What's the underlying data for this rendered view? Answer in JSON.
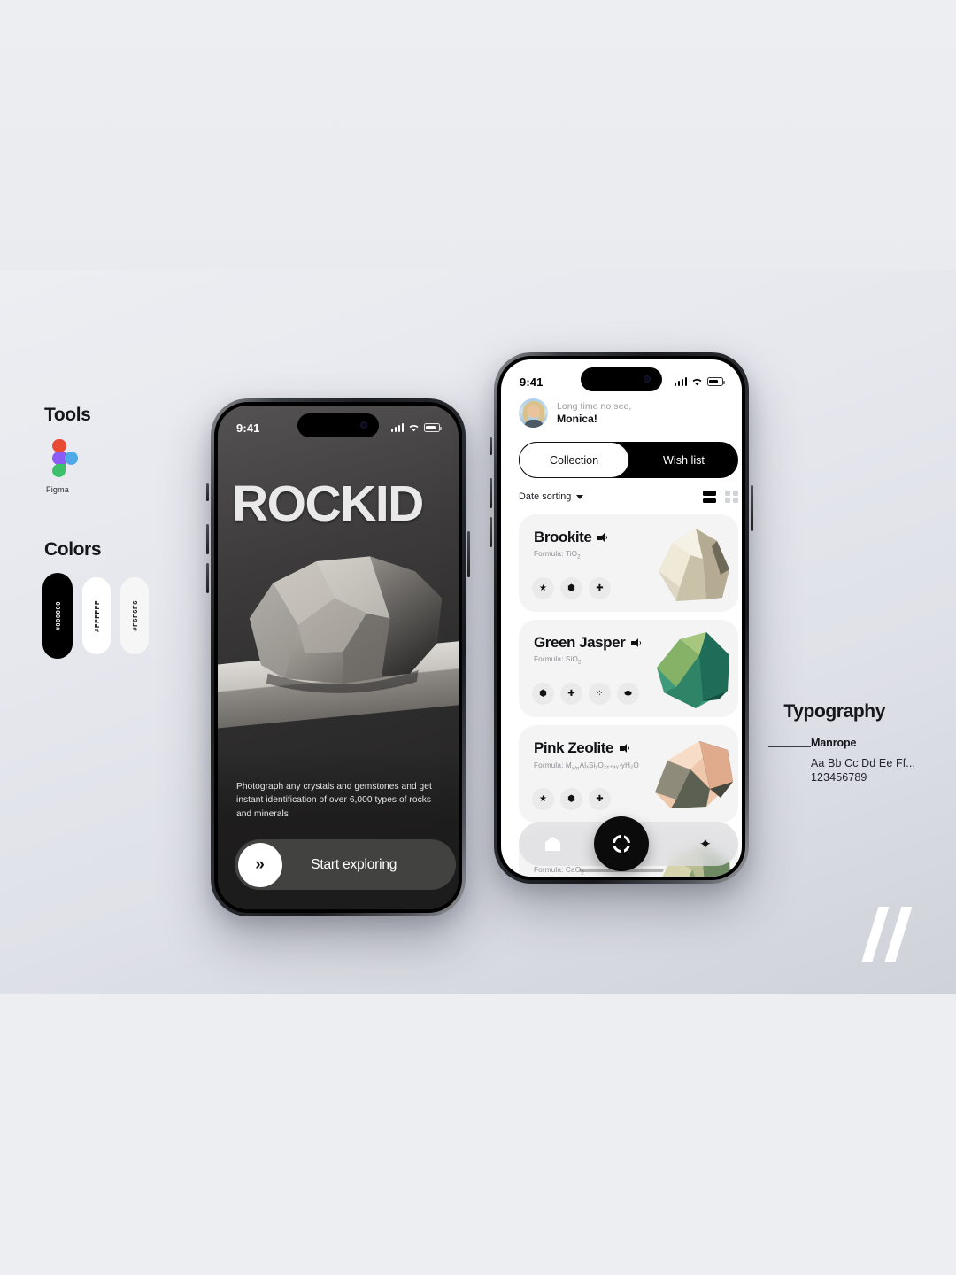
{
  "sidebar": {
    "tools": {
      "label": "Tools",
      "items": [
        {
          "name": "Figma",
          "icon": "figma-logo"
        }
      ]
    },
    "colors": {
      "label": "Colors",
      "swatches": [
        {
          "hex": "#000000",
          "label": "#000000"
        },
        {
          "hex": "#FFFFFF",
          "label": "#FFFFFF"
        },
        {
          "hex": "#F6F6F6",
          "label": "#F6F6F6"
        }
      ]
    }
  },
  "typography": {
    "label": "Typography",
    "font_name": "Manrope",
    "sample_letters": "Aa Bb Cc Dd Ee Ff...",
    "sample_numbers": "123456789"
  },
  "brand_mark": "double-slash",
  "phone_hero": {
    "status": {
      "time": "9:41",
      "signal": "signal-icon",
      "wifi": "wifi-icon",
      "battery": "battery-icon"
    },
    "title": "ROCKID",
    "description": "Photograph any crystals and gemstones and get instant identification of over 6,000 types of rocks and minerals",
    "cta": {
      "label": "Start exploring",
      "icon": "»"
    }
  },
  "phone_list": {
    "status": {
      "time": "9:41",
      "signal": "signal-icon",
      "wifi": "wifi-icon",
      "battery": "battery-icon"
    },
    "greeting": {
      "line1": "Long time no see,",
      "line2": "Monica!"
    },
    "tabs": [
      {
        "label": "Collection",
        "active": true
      },
      {
        "label": "Wish list",
        "active": false
      }
    ],
    "sort": {
      "label": "Date sorting"
    },
    "views": [
      {
        "name": "list-view",
        "active": true
      },
      {
        "name": "grid-view",
        "active": false
      }
    ],
    "cards": [
      {
        "name": "Brookite",
        "formula_prefix": "Formula: TiO",
        "formula_sub": "2",
        "chips": [
          "star-icon",
          "gem-icon",
          "plus-icon"
        ],
        "thumb_colors": [
          "#e8e3d2",
          "#cdc6ae",
          "#9c9481",
          "#6e6a5c"
        ]
      },
      {
        "name": "Green Jasper",
        "formula_prefix": "Formula: SiO",
        "formula_sub": "2",
        "chips": [
          "gem-icon",
          "plus-icon",
          "molecule-icon",
          "droplet-icon"
        ],
        "thumb_colors": [
          "#7fae6a",
          "#3e9b7e",
          "#2f7d6a",
          "#1f5a4c"
        ]
      },
      {
        "name": "Pink Zeolite",
        "formula_prefix": "Formula: M",
        "formula_sub": "x/n",
        "formula_rest": "AlₓSiᵧO₂ₓ₊₄ᵧ·yH₂O",
        "chips": [
          "star-icon",
          "gem-icon",
          "plus-icon"
        ],
        "thumb_colors": [
          "#f0cdb4",
          "#e0a98c",
          "#8f8b7c",
          "#4f5248"
        ]
      },
      {
        "name": "",
        "formula_prefix": "Formula: CaO",
        "formula_sub": "2",
        "chips": [],
        "thumb_colors": [
          "#c7c2a4",
          "#8fa37a",
          "#5f7b5a",
          "#3e5840"
        ]
      }
    ],
    "nav": [
      {
        "name": "home-icon"
      },
      {
        "name": "camera-button"
      },
      {
        "name": "sparkle-icon"
      }
    ]
  }
}
